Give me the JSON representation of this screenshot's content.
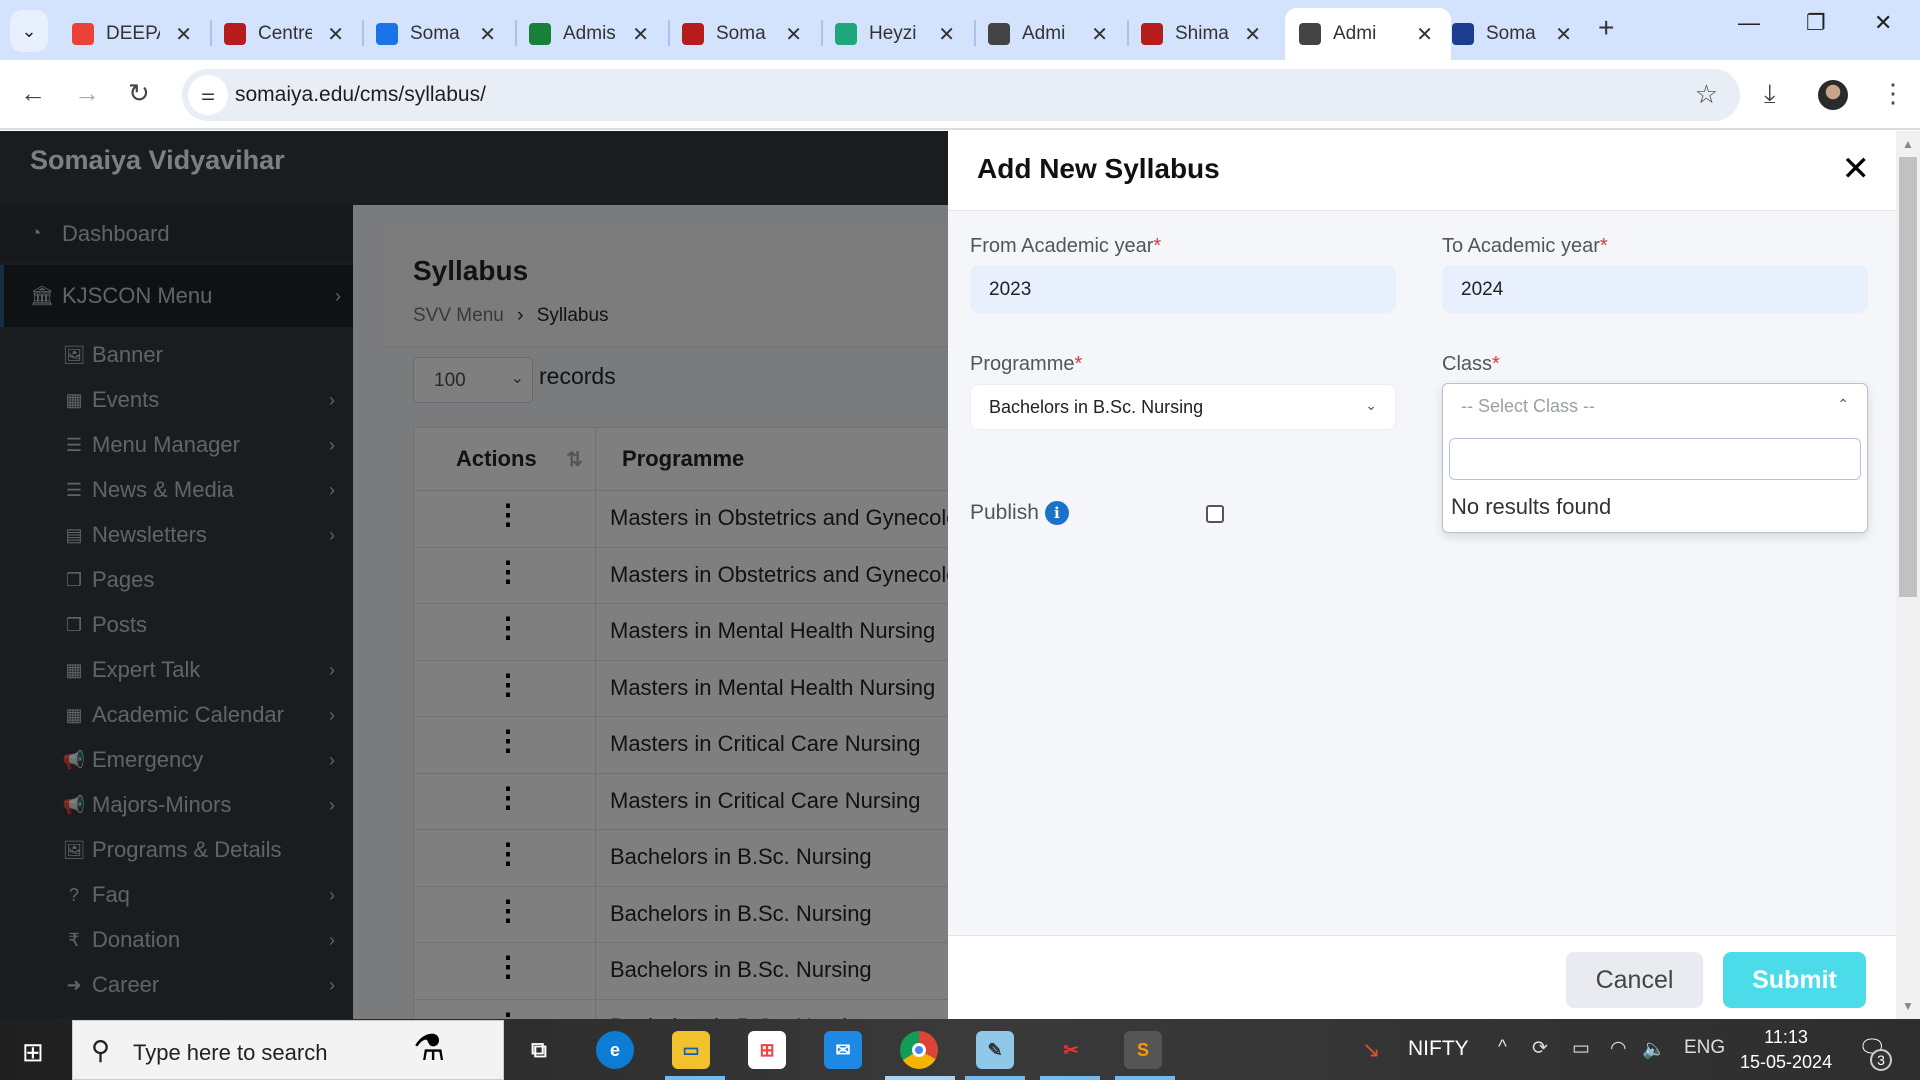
{
  "browser": {
    "tabs": [
      {
        "title": "DEEPA",
        "favicon": "gmail-icon",
        "color": "#ea4335"
      },
      {
        "title": "Centre",
        "favicon": "somaiya-icon",
        "color": "#b71c1c"
      },
      {
        "title": "Soma",
        "favicon": "calendar-icon",
        "color": "#1a73e8"
      },
      {
        "title": "Admis",
        "favicon": "sheets-icon",
        "color": "#188038"
      },
      {
        "title": "Soma",
        "favicon": "somaiya-icon",
        "color": "#b71c1c"
      },
      {
        "title": "Heyzi",
        "favicon": "heyzine-icon",
        "color": "#1fa67a"
      },
      {
        "title": "Admi",
        "favicon": "globe-icon",
        "color": "#444444"
      },
      {
        "title": "Shima",
        "favicon": "somaiya-icon",
        "color": "#b71c1c"
      },
      {
        "title": "Admi",
        "favicon": "globe-icon",
        "color": "#444444",
        "active": true
      },
      {
        "title": "Soma",
        "favicon": "somaiya-trust-icon",
        "color": "#1a3d8f"
      }
    ],
    "url": "somaiya.edu/cms/syllabus/"
  },
  "app": {
    "brand": "Somaiya Vidyavihar"
  },
  "sidebar": {
    "dashboard": "Dashboard",
    "menu": "KJSCON Menu",
    "items": [
      {
        "label": "Banner",
        "icon": "image-icon",
        "glyph": "🖼",
        "chevron": false
      },
      {
        "label": "Events",
        "icon": "calendar-icon",
        "glyph": "▦",
        "chevron": true
      },
      {
        "label": "Menu Manager",
        "icon": "list-icon",
        "glyph": "☰",
        "chevron": true
      },
      {
        "label": "News & Media",
        "icon": "list-icon",
        "glyph": "☰",
        "chevron": true
      },
      {
        "label": "Newsletters",
        "icon": "newspaper-icon",
        "glyph": "▤",
        "chevron": true
      },
      {
        "label": "Pages",
        "icon": "copy-icon",
        "glyph": "❐",
        "chevron": false
      },
      {
        "label": "Posts",
        "icon": "copy-icon",
        "glyph": "❐",
        "chevron": false
      },
      {
        "label": "Expert Talk",
        "icon": "calendar-icon",
        "glyph": "▦",
        "chevron": true
      },
      {
        "label": "Academic Calendar",
        "icon": "calendar-icon",
        "glyph": "▦",
        "chevron": true
      },
      {
        "label": "Emergency",
        "icon": "bullhorn-icon",
        "glyph": "📢",
        "chevron": true
      },
      {
        "label": "Majors-Minors",
        "icon": "bullhorn-icon",
        "glyph": "📢",
        "chevron": true
      },
      {
        "label": "Programs & Details",
        "icon": "image-icon",
        "glyph": "🖼",
        "chevron": false
      },
      {
        "label": "Faq",
        "icon": "question-circle-icon",
        "glyph": "?",
        "chevron": true
      },
      {
        "label": "Donation",
        "icon": "rupee-icon",
        "glyph": "₹",
        "chevron": true
      },
      {
        "label": "Career",
        "icon": "arrow-circle-icon",
        "glyph": "➜",
        "chevron": true
      }
    ]
  },
  "content": {
    "title": "Syllabus",
    "breadcrumb": {
      "home": "SVV Menu",
      "sep": "›",
      "current": "Syllabus"
    },
    "records_value": "100",
    "records_label": "records",
    "table": {
      "headers": [
        "Actions",
        "Programme"
      ],
      "rows": [
        "Masters in Obstetrics and Gynecology Nursing",
        "Masters in Obstetrics and Gynecology Nursing",
        "Masters in Mental Health Nursing",
        "Masters in Mental Health Nursing",
        "Masters in Critical Care Nursing",
        "Masters in Critical Care Nursing",
        "Bachelors in B.Sc. Nursing",
        "Bachelors in B.Sc. Nursing",
        "Bachelors in B.Sc. Nursing",
        "Bachelors in B.Sc. Nursing"
      ]
    }
  },
  "modal": {
    "title": "Add New Syllabus",
    "from_label": "From Academic year",
    "from_value": "2023",
    "to_label": "To Academic year",
    "to_value": "2024",
    "programme_label": "Programme",
    "programme_value": "Bachelors in B.Sc. Nursing",
    "class_label": "Class",
    "class_placeholder": "-- Select Class --",
    "class_search_value": "",
    "no_results": "No results found",
    "publish_label": "Publish",
    "publish_checked": false,
    "required_mark": "*",
    "cancel": "Cancel",
    "submit": "Submit",
    "submit_color": "#4cdbe8"
  },
  "taskbar": {
    "search_placeholder": "Type here to search",
    "ticker": "NIFTY",
    "language": "ENG",
    "time": "11:13",
    "date": "15-05-2024",
    "notifications": "3"
  }
}
